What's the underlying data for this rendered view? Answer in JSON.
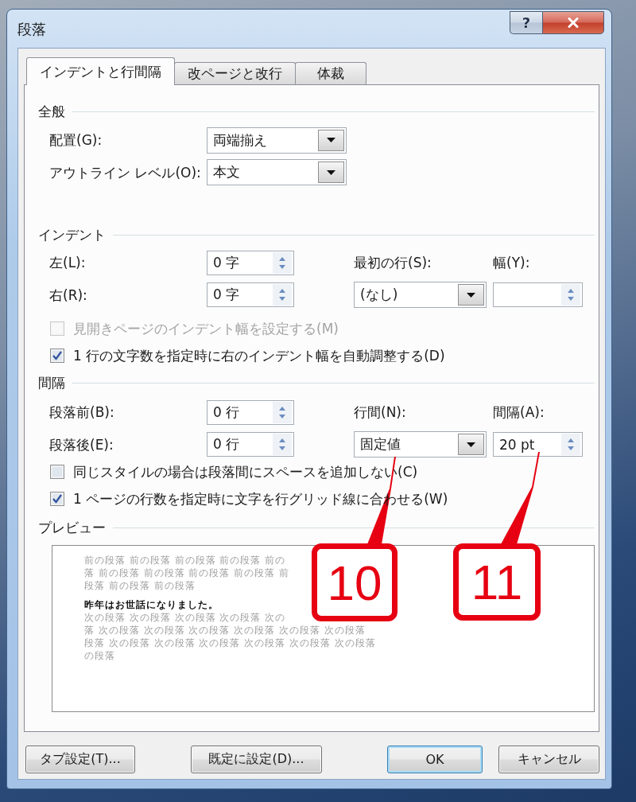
{
  "window": {
    "title": "段落",
    "help_label": "?"
  },
  "tabs": [
    {
      "label": "インデントと行間隔",
      "selected": true
    },
    {
      "label": "改ページと改行",
      "selected": false
    },
    {
      "label": "体裁",
      "selected": false
    }
  ],
  "general": {
    "heading": "全般",
    "fields": [
      {
        "label": "配置(G):",
        "value": "両端揃え"
      },
      {
        "label": "アウトライン レベル(O):",
        "value": "本文"
      }
    ]
  },
  "indent": {
    "heading": "インデント",
    "left": {
      "label": "左(L):",
      "value": "0 字"
    },
    "right": {
      "label": "右(R):",
      "value": "0 字"
    },
    "first_line": {
      "label": "最初の行(S):",
      "value": "(なし)"
    },
    "by": {
      "label": "幅(Y):"
    },
    "options": [
      {
        "label": "見開きページのインデント幅を設定する(M)",
        "checked": false,
        "disabled": true
      },
      {
        "label": "1 行の文字数を指定時に右のインデント幅を自動調整する(D)",
        "checked": true,
        "disabled": false
      }
    ]
  },
  "spacing": {
    "heading": "間隔",
    "before": {
      "label": "段落前(B):",
      "value": "0 行"
    },
    "after": {
      "label": "段落後(E):",
      "value": "0 行"
    },
    "line_spacing": {
      "label": "行間(N):",
      "value": "固定値"
    },
    "at": {
      "label": "間隔(A):",
      "value": "20 pt"
    },
    "options": [
      {
        "label": "同じスタイルの場合は段落間にスペースを追加しない(C)",
        "checked": false,
        "disabled": false
      },
      {
        "label": "1 ページの行数を指定時に文字を行グリッド線に合わせる(W)",
        "checked": true,
        "disabled": false
      }
    ]
  },
  "preview": {
    "heading": "プレビュー",
    "lines": [
      {
        "kind": "previous",
        "text": "前の段落 前の段落 前の段落 前の段落 前の"
      },
      {
        "kind": "previous",
        "text": "落 前の段落 前の段落 前の段落 前の段落 前"
      },
      {
        "kind": "previous",
        "text": "段落 前の段落 前の段落"
      },
      {
        "kind": "sample",
        "text": "昨年はお世話になりました。"
      },
      {
        "kind": "next",
        "text": "次の段落 次の段落 次の段落 次の段落 次の"
      },
      {
        "kind": "next",
        "text": "落 次の段落 次の段落 次の段落 次の段落 次の段落 次の段落"
      },
      {
        "kind": "next",
        "text": "段落 次の段落 次の段落 次の段落 次の段落 次の段落 次の段落"
      },
      {
        "kind": "next",
        "text": "の段落"
      }
    ]
  },
  "buttons": [
    {
      "label": "タブ設定(T)...",
      "default": false
    },
    {
      "label": "既定に設定(D)...",
      "default": false
    },
    {
      "label": "OK",
      "default": true
    },
    {
      "label": "キャンセル",
      "default": false
    }
  ],
  "callouts": [
    {
      "label": "10"
    },
    {
      "label": "11"
    }
  ]
}
